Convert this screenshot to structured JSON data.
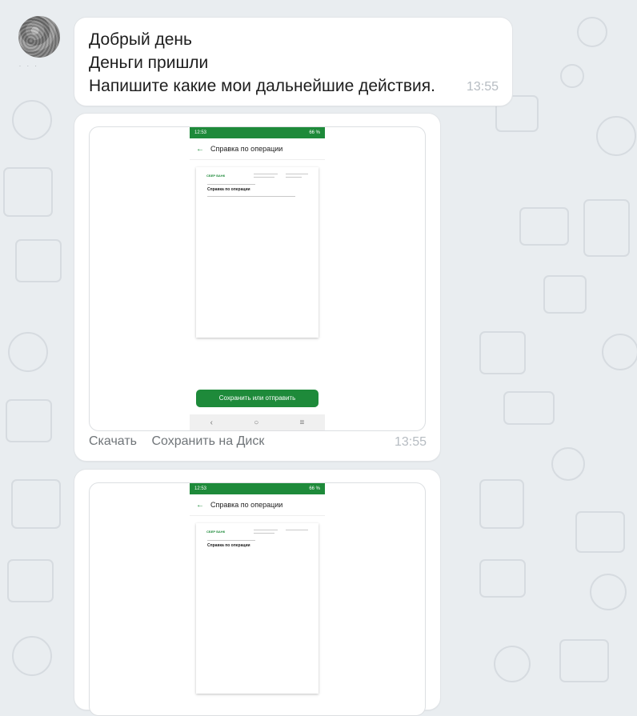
{
  "messages": {
    "line1": "Добрый день",
    "line2": "Деньги пришли",
    "line3": "Напишите какие мои дальнейшие действия.",
    "time": "13:55"
  },
  "image_message": {
    "download_label": "Скачать",
    "save_disk_label": "Сохранить на Диск",
    "time": "13:55"
  },
  "phone": {
    "status_time_1": "12:53",
    "status_time_2": "12:53",
    "status_right": "66 %",
    "screen_title": "Справка по операции",
    "doc_logo": "СБЕР БАНК",
    "doc_title": "Справка по операции",
    "save_button": "Сохранить или отправить"
  },
  "icons": {
    "back": "arrow-left-icon",
    "nav_back": "chevron-left-icon",
    "nav_home": "circle-icon",
    "nav_menu": "menu-icon"
  },
  "colors": {
    "accent_green": "#1e8a3a",
    "background": "#e9edf0"
  }
}
